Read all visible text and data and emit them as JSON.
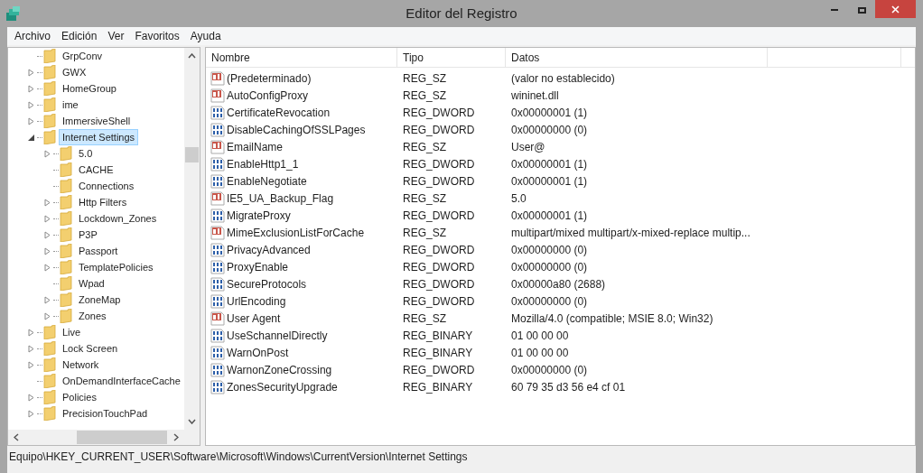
{
  "window": {
    "title": "Editor del Registro"
  },
  "menu": [
    "Archivo",
    "Edición",
    "Ver",
    "Favoritos",
    "Ayuda"
  ],
  "tree": [
    {
      "label": "GrpConv",
      "expandable": false,
      "selected": false
    },
    {
      "label": "GWX",
      "expandable": true,
      "expanded": false,
      "selected": false
    },
    {
      "label": "HomeGroup",
      "expandable": true,
      "expanded": false,
      "selected": false
    },
    {
      "label": "ime",
      "expandable": true,
      "expanded": false,
      "selected": false
    },
    {
      "label": "ImmersiveShell",
      "expandable": true,
      "expanded": false,
      "selected": false
    },
    {
      "label": "Internet Settings",
      "expandable": true,
      "expanded": true,
      "selected": true,
      "children": [
        {
          "label": "5.0",
          "expandable": true,
          "expanded": false,
          "selected": false
        },
        {
          "label": "CACHE",
          "expandable": false,
          "selected": false
        },
        {
          "label": "Connections",
          "expandable": false,
          "selected": false
        },
        {
          "label": "Http Filters",
          "expandable": true,
          "expanded": false,
          "selected": false
        },
        {
          "label": "Lockdown_Zones",
          "expandable": true,
          "expanded": false,
          "selected": false
        },
        {
          "label": "P3P",
          "expandable": true,
          "expanded": false,
          "selected": false
        },
        {
          "label": "Passport",
          "expandable": true,
          "expanded": false,
          "selected": false
        },
        {
          "label": "TemplatePolicies",
          "expandable": true,
          "expanded": false,
          "selected": false
        },
        {
          "label": "Wpad",
          "expandable": false,
          "selected": false
        },
        {
          "label": "ZoneMap",
          "expandable": true,
          "expanded": false,
          "selected": false
        },
        {
          "label": "Zones",
          "expandable": true,
          "expanded": false,
          "selected": false
        }
      ]
    },
    {
      "label": "Live",
      "expandable": true,
      "expanded": false,
      "selected": false
    },
    {
      "label": "Lock Screen",
      "expandable": true,
      "expanded": false,
      "selected": false
    },
    {
      "label": "Network",
      "expandable": true,
      "expanded": false,
      "selected": false
    },
    {
      "label": "OnDemandInterfaceCache",
      "expandable": false,
      "selected": false
    },
    {
      "label": "Policies",
      "expandable": true,
      "expanded": false,
      "selected": false
    },
    {
      "label": "PrecisionTouchPad",
      "expandable": true,
      "expanded": false,
      "selected": false
    }
  ],
  "table": {
    "columns": [
      "Nombre",
      "Tipo",
      "Datos"
    ],
    "rows": [
      {
        "kind": "string",
        "name": "(Predeterminado)",
        "type": "REG_SZ",
        "data": "(valor no establecido)"
      },
      {
        "kind": "string",
        "name": "AutoConfigProxy",
        "type": "REG_SZ",
        "data": "wininet.dll"
      },
      {
        "kind": "binary",
        "name": "CertificateRevocation",
        "type": "REG_DWORD",
        "data": "0x00000001 (1)"
      },
      {
        "kind": "binary",
        "name": "DisableCachingOfSSLPages",
        "type": "REG_DWORD",
        "data": "0x00000000 (0)"
      },
      {
        "kind": "string",
        "name": "EmailName",
        "type": "REG_SZ",
        "data": "User@"
      },
      {
        "kind": "binary",
        "name": "EnableHttp1_1",
        "type": "REG_DWORD",
        "data": "0x00000001 (1)"
      },
      {
        "kind": "binary",
        "name": "EnableNegotiate",
        "type": "REG_DWORD",
        "data": "0x00000001 (1)"
      },
      {
        "kind": "string",
        "name": "IE5_UA_Backup_Flag",
        "type": "REG_SZ",
        "data": "5.0"
      },
      {
        "kind": "binary",
        "name": "MigrateProxy",
        "type": "REG_DWORD",
        "data": "0x00000001 (1)"
      },
      {
        "kind": "string",
        "name": "MimeExclusionListForCache",
        "type": "REG_SZ",
        "data": "multipart/mixed multipart/x-mixed-replace multip..."
      },
      {
        "kind": "binary",
        "name": "PrivacyAdvanced",
        "type": "REG_DWORD",
        "data": "0x00000000 (0)"
      },
      {
        "kind": "binary",
        "name": "ProxyEnable",
        "type": "REG_DWORD",
        "data": "0x00000000 (0)"
      },
      {
        "kind": "binary",
        "name": "SecureProtocols",
        "type": "REG_DWORD",
        "data": "0x00000a80 (2688)"
      },
      {
        "kind": "binary",
        "name": "UrlEncoding",
        "type": "REG_DWORD",
        "data": "0x00000000 (0)"
      },
      {
        "kind": "string",
        "name": "User Agent",
        "type": "REG_SZ",
        "data": "Mozilla/4.0 (compatible; MSIE 8.0; Win32)"
      },
      {
        "kind": "binary",
        "name": "UseSchannelDirectly",
        "type": "REG_BINARY",
        "data": "01 00 00 00"
      },
      {
        "kind": "binary",
        "name": "WarnOnPost",
        "type": "REG_BINARY",
        "data": "01 00 00 00"
      },
      {
        "kind": "binary",
        "name": "WarnonZoneCrossing",
        "type": "REG_DWORD",
        "data": "0x00000000 (0)"
      },
      {
        "kind": "binary",
        "name": "ZonesSecurityUpgrade",
        "type": "REG_BINARY",
        "data": "60 79 35 d3 56 e4 cf 01"
      }
    ]
  },
  "status_bar": "Equipo\\HKEY_CURRENT_USER\\Software\\Microsoft\\Windows\\CurrentVersion\\Internet Settings"
}
